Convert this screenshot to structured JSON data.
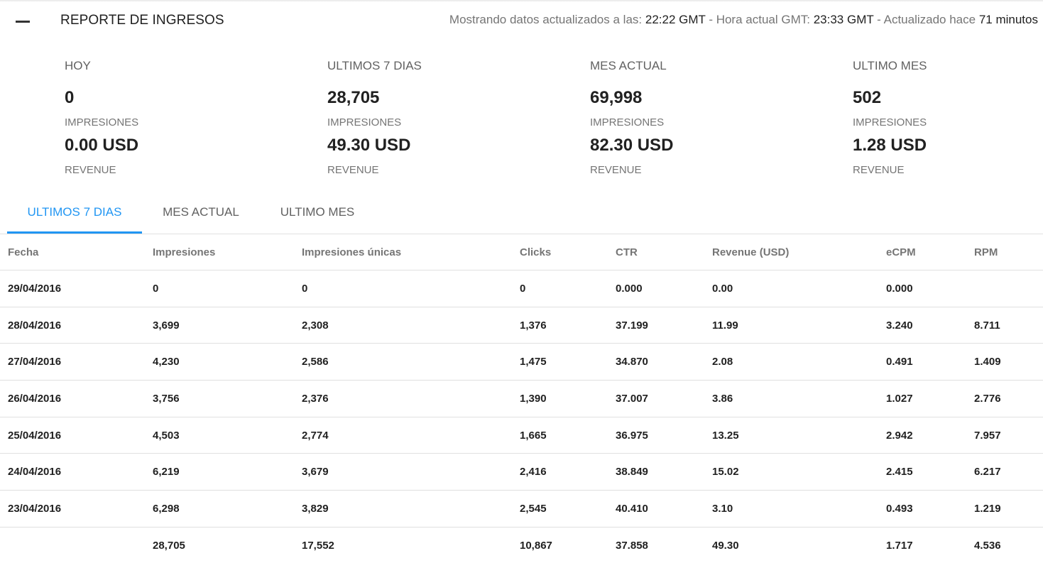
{
  "header": {
    "title": "REPORTE DE INGRESOS",
    "status_prefix": "Mostrando datos actualizados a las:",
    "updated_time": "22:22 GMT",
    "current_prefix": " - Hora actual GMT:",
    "current_time": "23:33 GMT",
    "ago_prefix": " - Actualizado hace",
    "ago_value": "71 minutos"
  },
  "stats": [
    {
      "period": "HOY",
      "impressions": "0",
      "impressions_label": "IMPRESIONES",
      "revenue": "0.00 USD",
      "revenue_label": "REVENUE"
    },
    {
      "period": "ULTIMOS 7 DIAS",
      "impressions": "28,705",
      "impressions_label": "IMPRESIONES",
      "revenue": "49.30 USD",
      "revenue_label": "REVENUE"
    },
    {
      "period": "MES ACTUAL",
      "impressions": "69,998",
      "impressions_label": "IMPRESIONES",
      "revenue": "82.30 USD",
      "revenue_label": "REVENUE"
    },
    {
      "period": "ULTIMO MES",
      "impressions": "502",
      "impressions_label": "IMPRESIONES",
      "revenue": "1.28 USD",
      "revenue_label": "REVENUE"
    }
  ],
  "tabs": [
    {
      "label": "ULTIMOS 7 DIAS",
      "active": true
    },
    {
      "label": "MES ACTUAL",
      "active": false
    },
    {
      "label": "ULTIMO MES",
      "active": false
    }
  ],
  "accent_color": "#2196f3",
  "table": {
    "columns": [
      "Fecha",
      "Impresiones",
      "Impresiones únicas",
      "Clicks",
      "CTR",
      "Revenue (USD)",
      "eCPM",
      "RPM"
    ],
    "rows": [
      [
        "29/04/2016",
        "0",
        "0",
        "0",
        "0.000",
        "0.00",
        "0.000",
        ""
      ],
      [
        "28/04/2016",
        "3,699",
        "2,308",
        "1,376",
        "37.199",
        "11.99",
        "3.240",
        "8.711"
      ],
      [
        "27/04/2016",
        "4,230",
        "2,586",
        "1,475",
        "34.870",
        "2.08",
        "0.491",
        "1.409"
      ],
      [
        "26/04/2016",
        "3,756",
        "2,376",
        "1,390",
        "37.007",
        "3.86",
        "1.027",
        "2.776"
      ],
      [
        "25/04/2016",
        "4,503",
        "2,774",
        "1,665",
        "36.975",
        "13.25",
        "2.942",
        "7.957"
      ],
      [
        "24/04/2016",
        "6,219",
        "3,679",
        "2,416",
        "38.849",
        "15.02",
        "2.415",
        "6.217"
      ],
      [
        "23/04/2016",
        "6,298",
        "3,829",
        "2,545",
        "40.410",
        "3.10",
        "0.493",
        "1.219"
      ],
      [
        "",
        "28,705",
        "17,552",
        "10,867",
        "37.858",
        "49.30",
        "1.717",
        "4.536"
      ]
    ]
  }
}
